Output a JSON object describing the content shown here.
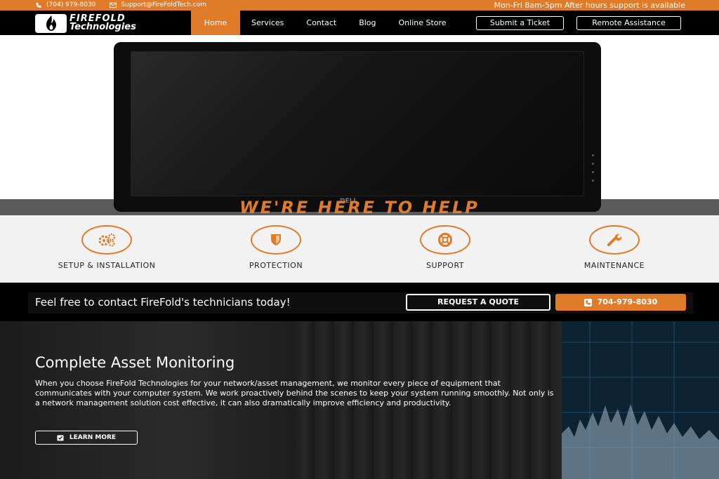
{
  "topbar": {
    "phone": "(704) 979-8030",
    "email": "Support@FireFoldTech.com",
    "hours": "Mon-Fri 8am-5pm After hours support is available"
  },
  "logo": {
    "line1": "FIREFOLD",
    "line2": "Technologies"
  },
  "nav": {
    "items": [
      "Home",
      "Services",
      "Contact",
      "Blog",
      "Online Store"
    ],
    "active": "Home",
    "submit_ticket": "Submit a Ticket",
    "remote_assistance": "Remote Assistance"
  },
  "hero": {
    "monitor_brand": "DELL",
    "title": "WE'RE HERE TO HELP"
  },
  "features": [
    {
      "label": "SETUP & INSTALLATION",
      "icon": "gears-icon"
    },
    {
      "label": "PROTECTION",
      "icon": "shield-icon"
    },
    {
      "label": "SUPPORT",
      "icon": "lifebuoy-icon"
    },
    {
      "label": "MAINTENANCE",
      "icon": "wrench-icon"
    }
  ],
  "cta": {
    "text": "Feel free to contact FireFold's technicians today!",
    "quote_label": "REQUEST A QUOTE",
    "phone_label": "704-979-8030"
  },
  "monitoring": {
    "title": "Complete Asset Monitoring",
    "paragraph": "When you choose FireFold Technologies for your network/asset management, we monitor every piece of equipment that communicates with your computer system. We work proactively behind the scenes to keep your system running smoothly. Not only is a network management solution cost effective, it can also dramatically improve efficiency and productivity.",
    "learn_more": "LEARN MORE"
  },
  "colors": {
    "accent": "#e07b2a",
    "dark": "#000000",
    "light": "#f2f2f2"
  }
}
